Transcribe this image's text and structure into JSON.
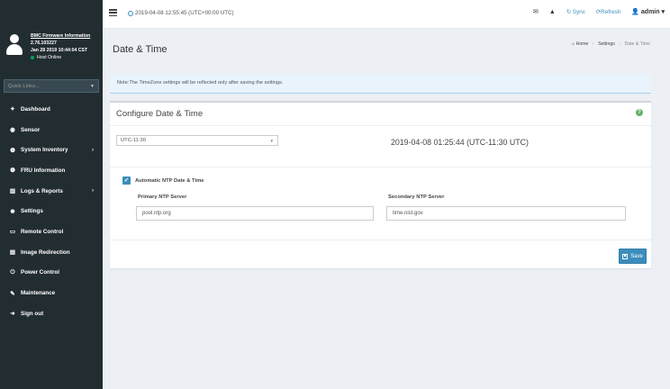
{
  "sidebar": {
    "user": {
      "title": "BMC Firmware Information",
      "version": "2.76.103227",
      "build_date": "Jan 28 2019 10:44:04 CST",
      "status": "Host Online",
      "status_color": "#00a65a"
    },
    "quick_links": {
      "placeholder": "Quick Links..."
    },
    "items": [
      {
        "label": "Dashboard",
        "icon": "dashboard-icon",
        "glyph": "✦"
      },
      {
        "label": "Sensor",
        "icon": "sensor-icon",
        "glyph": "◉"
      },
      {
        "label": "System Inventory",
        "icon": "info-icon",
        "glyph": "❶",
        "has_submenu": true
      },
      {
        "label": "FRU Information",
        "icon": "info-icon",
        "glyph": "❶"
      },
      {
        "label": "Logs & Reports",
        "icon": "chart-icon",
        "glyph": "▥",
        "has_submenu": true
      },
      {
        "label": "Settings",
        "icon": "gear-icon",
        "glyph": "✹"
      },
      {
        "label": "Remote Control",
        "icon": "monitor-icon",
        "glyph": "▭"
      },
      {
        "label": "Image Redirection",
        "icon": "disk-icon",
        "glyph": "▤"
      },
      {
        "label": "Power Control",
        "icon": "power-icon",
        "glyph": "⏻"
      },
      {
        "label": "Maintenance",
        "icon": "wrench-icon",
        "glyph": "✎"
      },
      {
        "label": "Sign out",
        "icon": "signout-icon",
        "glyph": "➜"
      }
    ]
  },
  "header": {
    "datetime": "2019-04-08 12:55:45 (UTC+00:00 UTC)",
    "sync_label": "Sync",
    "refresh_label": "Refresh",
    "user_label": "admin",
    "envelope_glyph": "✉",
    "warning_glyph": "▲",
    "user_glyph": "👤"
  },
  "page": {
    "title": "Date & Time",
    "breadcrumb": {
      "home": "Home",
      "settings": "Settings",
      "current": "Date & Time"
    },
    "note": "Note:The TimeZone settings will be reflected only after saving the settings."
  },
  "form": {
    "box_title": "Configure Date & Time",
    "timezone": "UTC-11:30",
    "current_datetime": "2019-04-08 01:25:44 (UTC-11:30 UTC)",
    "ntp_checkbox_label": "Automatic NTP Date & Time",
    "ntp_checked": true,
    "primary_label": "Primary NTP Server",
    "primary_value": "pool.ntp.org",
    "secondary_label": "Secondary NTP Server",
    "secondary_value": "time.nist.gov",
    "save_label": "Save"
  },
  "colors": {
    "sidebar_bg": "#222d32",
    "accent": "#3c8dbc",
    "help": "#67b168",
    "note_bg": "#e8f3fb"
  }
}
